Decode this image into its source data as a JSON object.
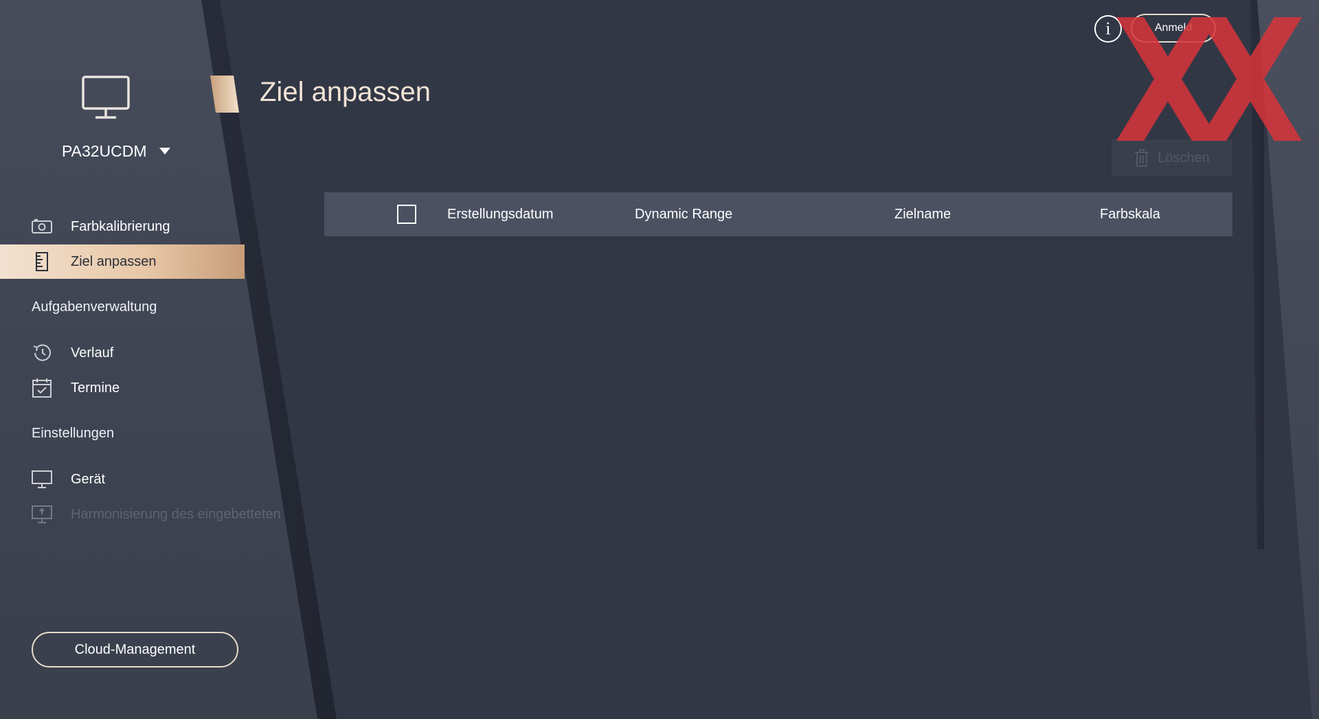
{
  "device": {
    "name": "PA32UCDM",
    "icon": "monitor-icon"
  },
  "sidebar": {
    "items": [
      {
        "label": "Farbkalibrierung",
        "icon": "camera-icon"
      },
      {
        "label": "Ziel anpassen",
        "icon": "ruler-icon",
        "active": true
      }
    ],
    "sections": [
      {
        "label": "Aufgabenverwaltung",
        "items": [
          {
            "label": "Verlauf",
            "icon": "history-icon"
          },
          {
            "label": "Termine",
            "icon": "calendar-check-icon"
          }
        ]
      },
      {
        "label": "Einstellungen",
        "items": [
          {
            "label": "Gerät",
            "icon": "monitor-icon"
          },
          {
            "label": "Harmonisierung des eingebetteten",
            "icon": "monitor-sync-icon",
            "disabled": true
          }
        ]
      }
    ],
    "cloud_button": "Cloud-Management"
  },
  "header": {
    "title": "Ziel anpassen",
    "info_icon": "i",
    "login_label": "Anmeld"
  },
  "toolbar": {
    "delete_label": "Löschen",
    "delete_icon": "trash-icon"
  },
  "table": {
    "columns": [
      "Erstellungsdatum",
      "Dynamic Range",
      "Zielname",
      "Farbskala"
    ],
    "rows": []
  },
  "colors": {
    "accent": "#e7c7a6",
    "background": "#323745",
    "sidebar": "#474c5b",
    "table_header": "#4c5162",
    "watermark": "#d9343a"
  }
}
